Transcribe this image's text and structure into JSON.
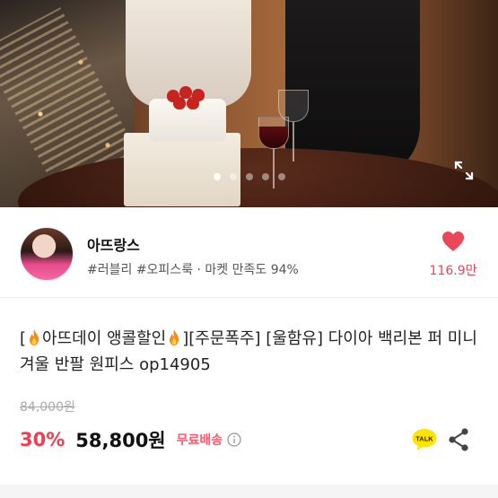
{
  "hero": {
    "image_alt": "product photo",
    "slide_count": 5,
    "active_slide": 1
  },
  "seller": {
    "name": "아뜨랑스",
    "meta": "#러블리 #오피스룩 · 마켓 만족도 94%",
    "likes": "116.9만"
  },
  "product": {
    "title_part1": "[",
    "title_part2": "아뜨데이 앵콜할인",
    "title_part3": "][주문폭주] [울함유] 다이아 백리본 퍼 미니 겨울 반팔 원피스 op14905",
    "original_price": "84,000원",
    "discount": "30%",
    "price": "58,800원",
    "shipping": "무료배송"
  },
  "actions": {
    "talk_label": "TALK"
  },
  "colors": {
    "accent": "#ef3e4d",
    "like": "#e8485a",
    "shipping": "#ff5a6e",
    "talk_yellow": "#fee500"
  }
}
